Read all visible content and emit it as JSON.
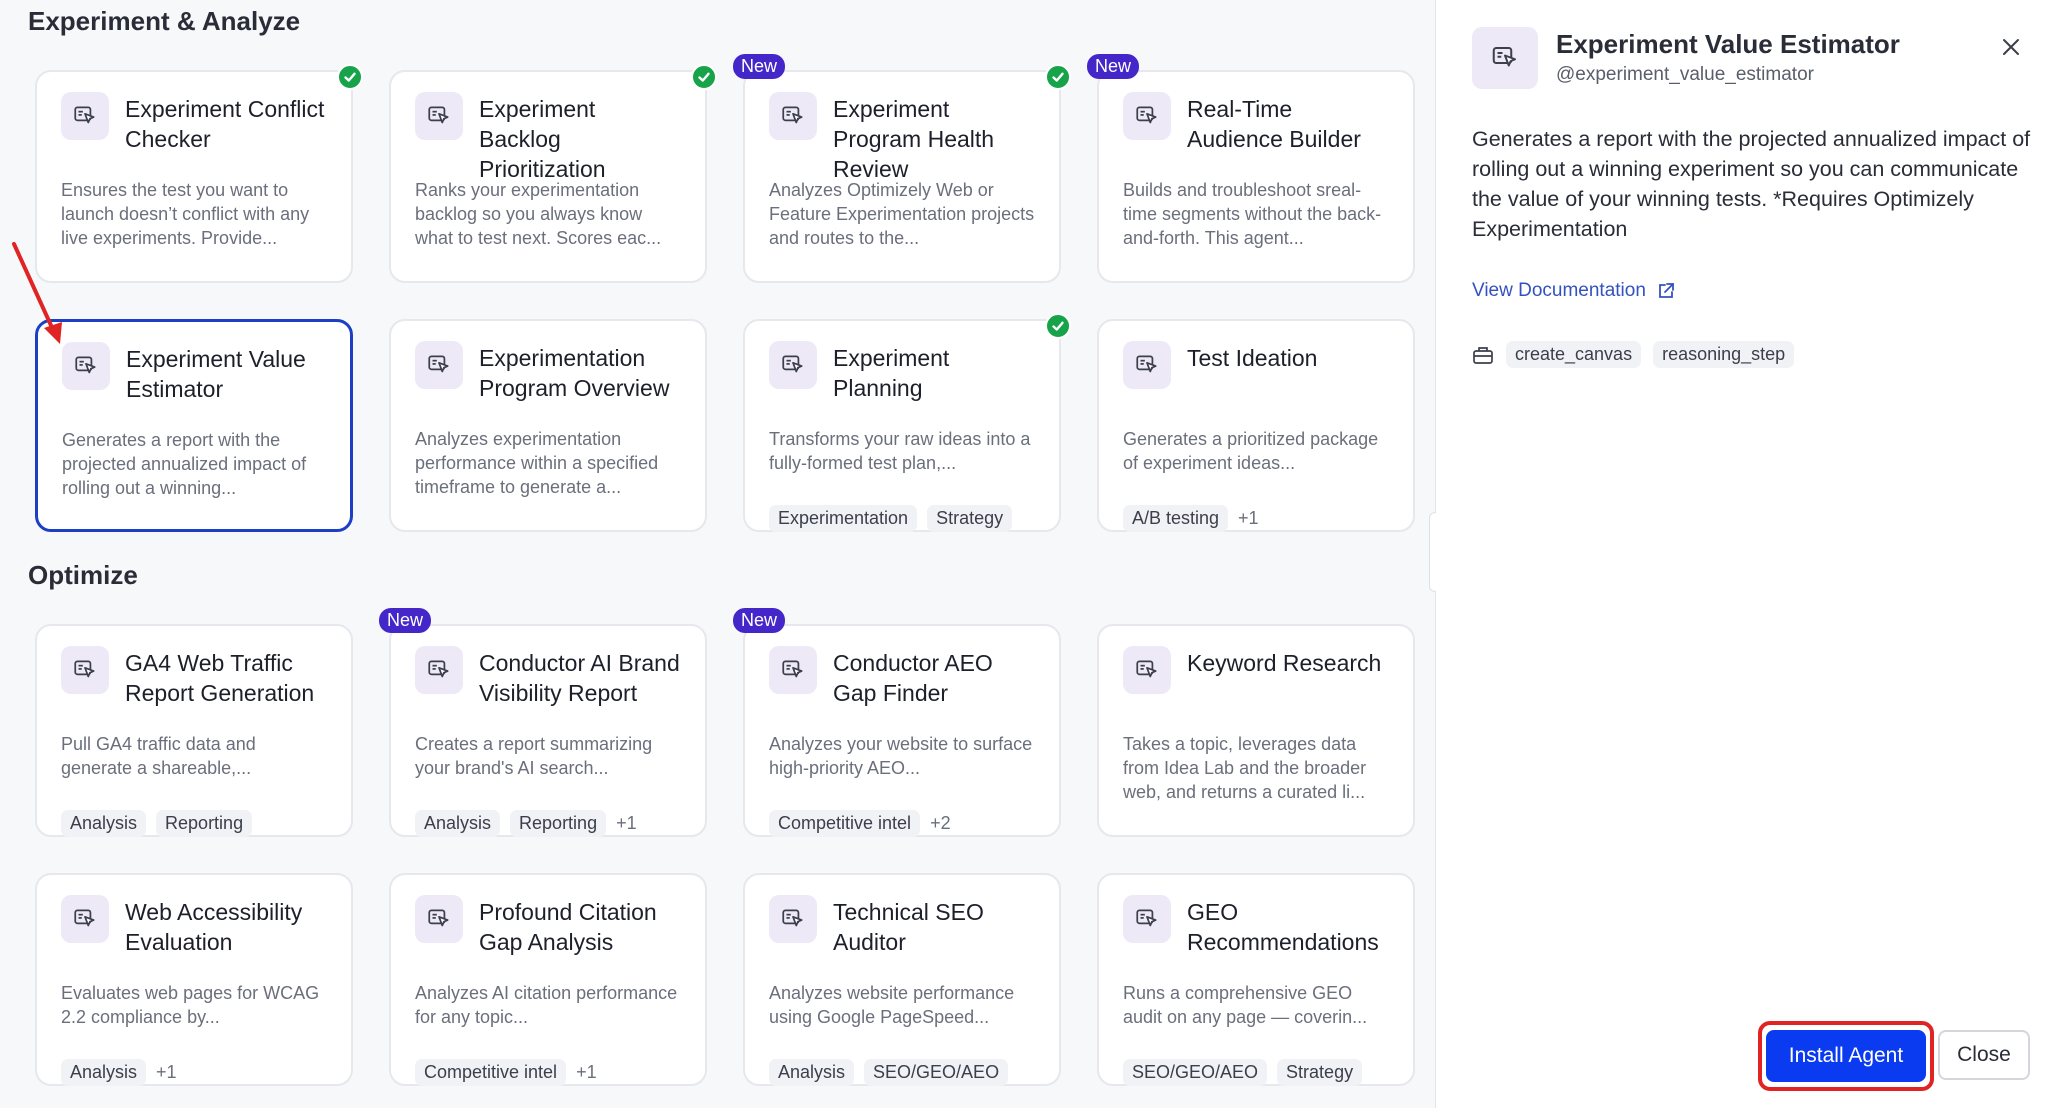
{
  "sections": [
    {
      "title": "Experiment & Analyze",
      "cards": [
        {
          "title": "Experiment Conflict Checker",
          "desc": "Ensures the test you want to launch doesn’t conflict with any live experiments. Provide...",
          "installed": true,
          "new": false,
          "tags": [],
          "more": ""
        },
        {
          "title": "Experiment Backlog Prioritization",
          "desc": "Ranks your experimentation backlog so you always know what to test next. Scores eac...",
          "installed": true,
          "new": false,
          "tags": [],
          "more": ""
        },
        {
          "title": "Experiment Program Health Review",
          "desc": "Analyzes Optimizely Web or Feature Experimentation projects and routes to the...",
          "installed": true,
          "new": true,
          "tags": [],
          "more": ""
        },
        {
          "title": "Real-Time Audience Builder",
          "desc": "Builds and troubleshoot sreal-time segments without the back-and-forth. This agent...",
          "installed": false,
          "new": true,
          "tags": [],
          "more": ""
        },
        {
          "title": "Experiment Value Estimator",
          "desc": "Generates a report with the projected annualized impact of rolling out a winning...",
          "installed": false,
          "new": false,
          "selected": true,
          "tags": [],
          "more": ""
        },
        {
          "title": "Experimentation Program Overview",
          "desc": "Analyzes experimentation performance within a specified timeframe to generate a...",
          "installed": false,
          "new": false,
          "tags": [],
          "more": ""
        },
        {
          "title": "Experiment Planning",
          "desc": "Transforms your raw ideas into a fully-formed test plan,...",
          "installed": true,
          "new": false,
          "tags": [
            "Experimentation",
            "Strategy"
          ],
          "more": ""
        },
        {
          "title": "Test Ideation",
          "desc": "Generates a prioritized package of experiment ideas...",
          "installed": false,
          "new": false,
          "tags": [
            "A/B testing"
          ],
          "more": "+1"
        }
      ]
    },
    {
      "title": "Optimize",
      "cards": [
        {
          "title": "GA4 Web Traffic Report Generation",
          "desc": "Pull GA4 traffic data and generate a shareable,...",
          "installed": false,
          "new": false,
          "tags": [
            "Analysis",
            "Reporting"
          ],
          "more": ""
        },
        {
          "title": "Conductor AI Brand Visibility Report",
          "desc": "Creates a report summarizing your brand's AI search...",
          "installed": false,
          "new": true,
          "tags": [
            "Analysis",
            "Reporting"
          ],
          "more": "+1"
        },
        {
          "title": "Conductor AEO Gap Finder",
          "desc": "Analyzes your website to surface high-priority AEO...",
          "installed": false,
          "new": true,
          "tags": [
            "Competitive intel"
          ],
          "more": "+2"
        },
        {
          "title": "Keyword Research",
          "desc": "Takes a topic, leverages data from Idea Lab and the broader web, and returns a curated li...",
          "installed": false,
          "new": false,
          "tags": [],
          "more": ""
        },
        {
          "title": "Web Accessibility Evaluation",
          "desc": "Evaluates web pages for WCAG 2.2 compliance by...",
          "installed": false,
          "new": false,
          "tags": [
            "Analysis"
          ],
          "more": "+1"
        },
        {
          "title": "Profound Citation Gap Analysis",
          "desc": "Analyzes AI citation performance for any topic...",
          "installed": false,
          "new": false,
          "tags": [
            "Competitive intel"
          ],
          "more": "+1"
        },
        {
          "title": "Technical SEO Auditor",
          "desc": "Analyzes website performance using Google PageSpeed...",
          "installed": false,
          "new": false,
          "tags": [
            "Analysis",
            "SEO/GEO/AEO"
          ],
          "more": ""
        },
        {
          "title": "GEO Recommendations",
          "desc": "Runs a comprehensive GEO audit on any page — coverin...",
          "installed": false,
          "new": false,
          "tags": [
            "SEO/GEO/AEO",
            "Strategy"
          ],
          "more": ""
        }
      ]
    }
  ],
  "badge_new_label": "New",
  "panel": {
    "title": "Experiment Value Estimator",
    "handle": "@experiment_value_estimator",
    "description": "Generates a report with the projected annualized impact of rolling out a winning experiment so you can communicate the value of your winning tests. *Requires Optimizely Experimentation",
    "doc_link": "View Documentation",
    "tools": [
      "create_canvas",
      "reasoning_step"
    ],
    "install_label": "Install Agent",
    "close_label": "Close"
  },
  "icons": {
    "agent": "agent-cursor-icon",
    "installed": "check-circle-icon",
    "close": "close-icon",
    "external": "external-link-icon",
    "tools": "toolbox-icon"
  },
  "colors": {
    "accent": "#0b3bf0",
    "new_badge": "#4527c9",
    "installed": "#17a34a",
    "highlight": "#e02424"
  }
}
